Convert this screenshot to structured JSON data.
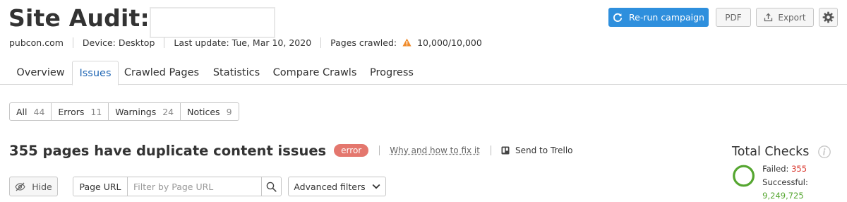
{
  "header": {
    "title": "Site Audit:",
    "domain": "pubcon.com",
    "device": "Device: Desktop",
    "last_update": "Last update: Tue, Mar 10, 2020",
    "pages_crawled_label": "Pages crawled:",
    "pages_crawled_value": "10,000/10,000"
  },
  "actions": {
    "rerun_label": "Re-run campaign",
    "pdf_label": "PDF",
    "export_label": "Export"
  },
  "tabs": [
    {
      "label": "Overview"
    },
    {
      "label": "Issues",
      "active": true
    },
    {
      "label": "Crawled Pages"
    },
    {
      "label": "Statistics"
    },
    {
      "label": "Compare Crawls"
    },
    {
      "label": "Progress"
    }
  ],
  "filters": [
    {
      "label": "All",
      "count": "44"
    },
    {
      "label": "Errors",
      "count": "11"
    },
    {
      "label": "Warnings",
      "count": "24"
    },
    {
      "label": "Notices",
      "count": "9"
    }
  ],
  "issue": {
    "title": "355 pages have duplicate content issues",
    "badge": "error",
    "fix_link": "Why and how to fix it",
    "trello": "Send to Trello"
  },
  "controls": {
    "hide_label": "Hide",
    "page_url_label": "Page URL",
    "search_placeholder": "Filter by Page URL",
    "advanced_filters_label": "Advanced filters"
  },
  "total_checks": {
    "title": "Total Checks",
    "failed_label": "Failed:",
    "failed_value": "355",
    "successful_label": "Successful:",
    "successful_value": "9,249,725"
  },
  "colors": {
    "primary": "#2e8fdd",
    "tab_active": "#1f66b4",
    "error_badge": "#e4776e",
    "failed": "#d9342b",
    "success": "#55a630",
    "warning": "#f08c2c"
  }
}
